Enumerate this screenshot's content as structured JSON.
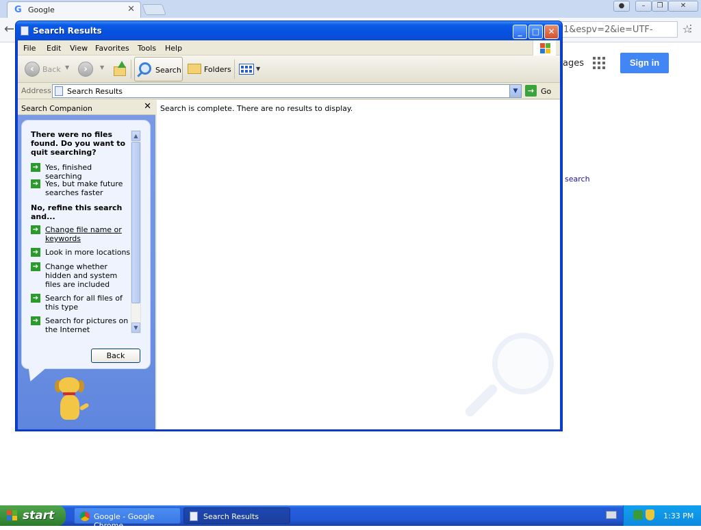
{
  "chrome": {
    "tab_title": "Google",
    "url_fragment": "1&espv=2&ie=UTF-",
    "images_link": "ages",
    "sign_in": "Sign in",
    "search_link": "search"
  },
  "window": {
    "title": "Search Results",
    "menu": [
      "File",
      "Edit",
      "View",
      "Favorites",
      "Tools",
      "Help"
    ],
    "toolbar": {
      "back": "Back",
      "search": "Search",
      "folders": "Folders"
    },
    "address": {
      "label": "Address",
      "value": "Search Results",
      "go": "Go"
    }
  },
  "companion": {
    "title": "Search Companion",
    "question": "There were no files found.  Do you want to quit searching?",
    "quit_options": [
      "Yes, finished searching",
      "Yes, but make future searches faster"
    ],
    "refine_heading": "No, refine this search and...",
    "refine_options": [
      "Change file name or keywords",
      "Look in more locations",
      "Change whether hidden and system files are included",
      "Search for all files of this type",
      "Search for pictures on the Internet"
    ],
    "back_button": "Back"
  },
  "results": {
    "message": "Search is complete. There are no results to display."
  },
  "taskbar": {
    "start": "start",
    "tasks": [
      "Google - Google Chrome",
      "Search Results"
    ],
    "clock": "1:33 PM"
  },
  "colors": {
    "title_bar": "#0651e0",
    "taskbar": "#245edb",
    "start_green": "#3a8c3a",
    "sign_in_blue": "#4285f4"
  }
}
